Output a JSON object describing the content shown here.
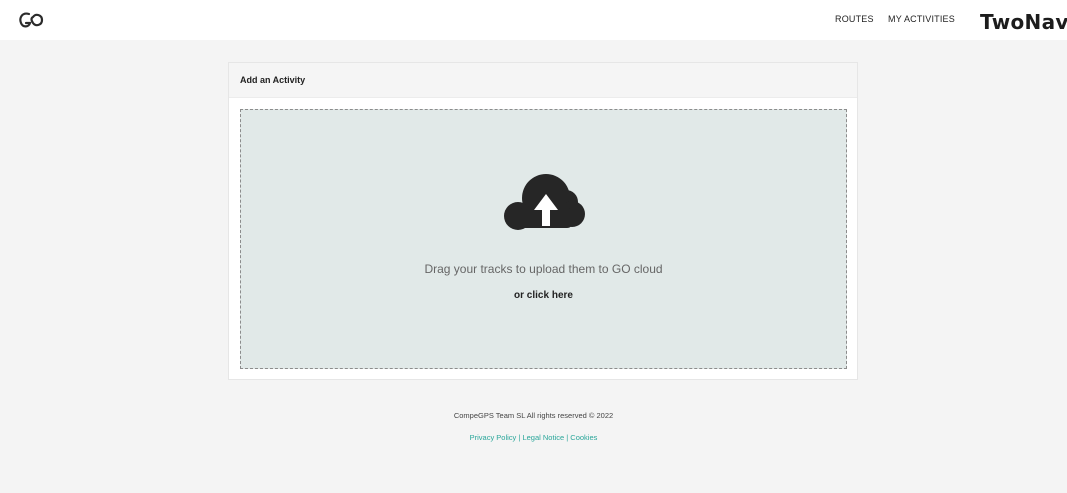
{
  "header": {
    "logo_icon": "go-logo-icon",
    "nav": {
      "routes": "ROUTES",
      "my_activities": "MY ACTIVITIES"
    },
    "brand": "TwoNav"
  },
  "card": {
    "title": "Add an Activity",
    "dropzone": {
      "icon": "cloud-upload-icon",
      "drag_text": "Drag your tracks to upload them to GO cloud",
      "click_text": "or click here"
    }
  },
  "footer": {
    "copyright": "CompeGPS Team SL All rights reserved © 2022",
    "links": {
      "privacy": "Privacy Policy",
      "legal": "Legal Notice",
      "cookies": "Cookies"
    },
    "separator": "|"
  },
  "colors": {
    "page_bg": "#f4f4f4",
    "dropzone_bg": "#e1e9e8",
    "link": "#2aa69a",
    "icon": "#262626"
  }
}
